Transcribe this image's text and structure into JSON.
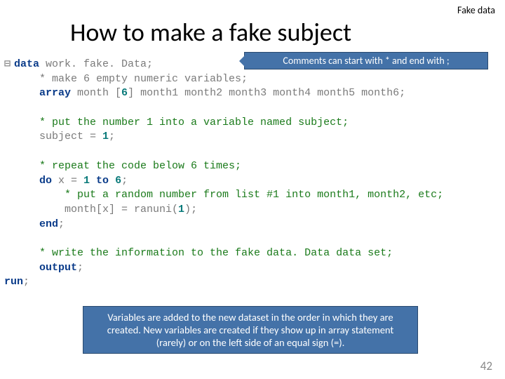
{
  "header": {
    "label": "Fake data"
  },
  "title": "How to make a fake subject",
  "callout_top": "Comments can start with * and end with ;",
  "callout_bottom": "Variables are added to the new dataset in the order in which they are created.  New variables are created if they show up in array statement (rarely) or on the left side of an equal sign (=).",
  "page_number": "42",
  "code": {
    "l1_kw1": "data",
    "l1_rest": " work. fake. Data;",
    "l2": "    * make 6 empty numeric variables;",
    "l3_kw": "    array",
    "l3_mid": " month ",
    "l3_num_open": "[",
    "l3_num": "6",
    "l3_num_close": "]",
    "l3_rest": " month1 month2 month3 month4 month5 month6;",
    "l5_cmt": "    * put the number 1 into a variable named subject;",
    "l6_a": "    subject = ",
    "l6_num": "1",
    "l6_b": ";",
    "l8_cmt": "    * repeat the code below 6 times;",
    "l9_kw1": "    do",
    "l9_mid1": " x = ",
    "l9_n1": "1",
    "l9_kw2": " to ",
    "l9_n2": "6",
    "l9_end": ";",
    "l10_cmt": "        * put a random number from list #1 into month1, month2, etc;",
    "l11_a": "        month[x] = ranuni(",
    "l11_n": "1",
    "l11_b": ");",
    "l12_kw": "    end",
    "l12_end": ";",
    "l14_cmt": "    * write the information to the fake data. Data data set;",
    "l15_kw": "    output",
    "l15_end": ";",
    "l16_kw": "run",
    "l16_end": ";"
  }
}
